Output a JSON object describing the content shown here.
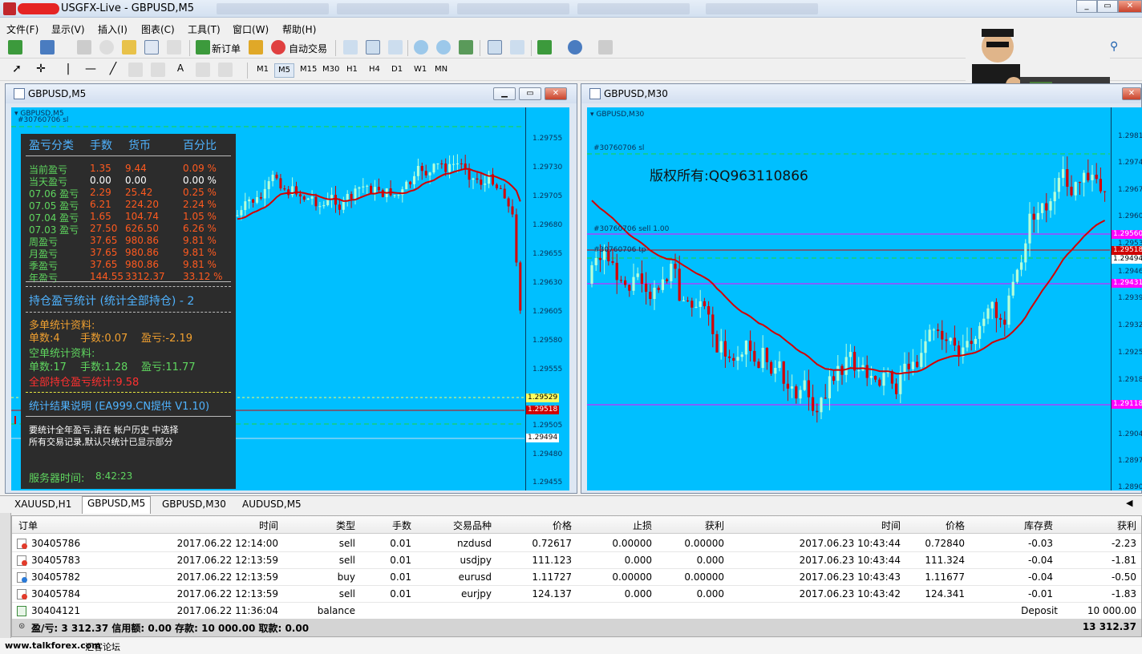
{
  "window": {
    "title": "USGFX-Live - GBPUSD,M5"
  },
  "menu": [
    "文件(F)",
    "显示(V)",
    "插入(I)",
    "图表(C)",
    "工具(T)",
    "窗口(W)",
    "帮助(H)"
  ],
  "toolbar": {
    "new_order": "新订单",
    "auto_trade": "自动交易",
    "timeframes": [
      "M1",
      "M5",
      "M15",
      "M30",
      "H1",
      "H4",
      "D1",
      "W1",
      "MN"
    ],
    "selected_tf": "M5"
  },
  "left_chart": {
    "window_title": "GBPUSD,M5",
    "symbol_label": "GBPUSD,M5",
    "order_label": "#30760706 sl",
    "price_ticks": [
      "1.29755",
      "1.29730",
      "1.29705",
      "1.29680",
      "1.29655",
      "1.29630",
      "1.29605",
      "1.29580",
      "1.29555",
      "1.29529",
      "1.29518",
      "1.29505",
      "1.29494",
      "1.29480",
      "1.29455"
    ],
    "tags": {
      "ask": "1.29529",
      "bid": "1.29518",
      "sl": "1.29494"
    }
  },
  "panel": {
    "headers": [
      "盈亏分类",
      "手数",
      "货币",
      "百分比"
    ],
    "rows": [
      {
        "label": "当前盈亏",
        "lots": "1.35",
        "money": "9.44",
        "pct": "0.09 %"
      },
      {
        "label": "当天盈亏",
        "lots": "0.00",
        "money": "0.00",
        "pct": "0.00 %"
      },
      {
        "label": "07.06 盈亏",
        "lots": "2.29",
        "money": "25.42",
        "pct": "0.25 %"
      },
      {
        "label": "07.05 盈亏",
        "lots": "6.21",
        "money": "224.20",
        "pct": "2.24 %"
      },
      {
        "label": "07.04 盈亏",
        "lots": "1.65",
        "money": "104.74",
        "pct": "1.05 %"
      },
      {
        "label": "07.03 盈亏",
        "lots": "27.50",
        "money": "626.50",
        "pct": "6.26 %"
      },
      {
        "label": "周盈亏",
        "lots": "37.65",
        "money": "980.86",
        "pct": "9.81 %"
      },
      {
        "label": "月盈亏",
        "lots": "37.65",
        "money": "980.86",
        "pct": "9.81 %"
      },
      {
        "label": "季盈亏",
        "lots": "37.65",
        "money": "980.86",
        "pct": "9.81 %"
      },
      {
        "label": "年盈亏",
        "lots": "144.55",
        "money": "3312.37",
        "pct": "33.12 %"
      }
    ],
    "section_title": "持仓盈亏统计 (统计全部持仓) - 2",
    "long_title": "多单统计资料:",
    "long_count": "单数:4",
    "long_lots": "手数:0.07",
    "long_pl": "盈亏:-2.19",
    "short_title": "空单统计资料:",
    "short_count": "单数:17",
    "short_lots": "手数:1.28",
    "short_pl": "盈亏:11.77",
    "total": "全部持仓盈亏统计:9.58",
    "note_title": "统计结果说明 (EA999.CN提供 V1.10)",
    "note_line1": "要统计全年盈亏,请在 帐户历史 中选择",
    "note_line2": "所有交易记录,默认只统计已显示部分",
    "server_time_label": "服务器时间:",
    "server_time": "8:42:23"
  },
  "right_chart": {
    "window_title": "GBPUSD,M30",
    "symbol_label": "GBPUSD,M30",
    "order_sl": "#30760706 sl",
    "order_sell": "#30760706 sell 1.00",
    "order_tp": "#30760706 tp",
    "watermark": "版权所有:QQ963110866",
    "price_ticks": [
      "1.29815",
      "1.29745",
      "1.29675",
      "1.29605",
      "1.29535",
      "1.29465",
      "1.29395",
      "1.29325",
      "1.29255",
      "1.29185",
      "1.29045",
      "1.28975",
      "1.28905"
    ],
    "tags": {
      "t1": "1.29560",
      "t2": "1.29518",
      "t3": "1.29494",
      "t4": "1.29431",
      "t5": "1.29118"
    }
  },
  "tabs": [
    "XAUUSD,H1",
    "GBPUSD,M5",
    "GBPUSD,M30",
    "AUDUSD,M5"
  ],
  "selected_tab": "GBPUSD,M5",
  "table": {
    "headers": [
      "订单",
      "时间",
      "类型",
      "手数",
      "交易品种",
      "价格",
      "止损",
      "获利",
      "时间",
      "价格",
      "库存费",
      "获利"
    ],
    "rows": [
      [
        "30405786",
        "2017.06.22 12:14:00",
        "sell",
        "0.01",
        "nzdusd",
        "0.72617",
        "0.00000",
        "0.00000",
        "2017.06.23 10:43:44",
        "0.72840",
        "-0.03",
        "-2.23"
      ],
      [
        "30405783",
        "2017.06.22 12:13:59",
        "sell",
        "0.01",
        "usdjpy",
        "111.123",
        "0.000",
        "0.000",
        "2017.06.23 10:43:44",
        "111.324",
        "-0.04",
        "-1.81"
      ],
      [
        "30405782",
        "2017.06.22 12:13:59",
        "buy",
        "0.01",
        "eurusd",
        "1.11727",
        "0.00000",
        "0.00000",
        "2017.06.23 10:43:43",
        "1.11677",
        "-0.04",
        "-0.50"
      ],
      [
        "30405784",
        "2017.06.22 12:13:59",
        "sell",
        "0.01",
        "eurjpy",
        "124.137",
        "0.000",
        "0.000",
        "2017.06.23 10:43:42",
        "124.341",
        "-0.01",
        "-1.83"
      ]
    ],
    "balance_row": {
      "order": "30404121",
      "time": "2017.06.22 11:36:04",
      "type": "balance",
      "comment": "Deposit",
      "amount": "10 000.00"
    },
    "summary": "盈/亏: 3 312.37  信用额: 0.00  存款: 10 000.00  取款: 0.00",
    "summary_total": "13 312.37"
  },
  "footer": {
    "site": "www.talkforex.com",
    "forum": "汇客论坛"
  },
  "colors": {
    "chart_bg": "#00bfff",
    "bull": "#b8ffd8",
    "bear": "#d40000",
    "ma": "#d40000",
    "panel_bg": "#2c2c2c"
  }
}
